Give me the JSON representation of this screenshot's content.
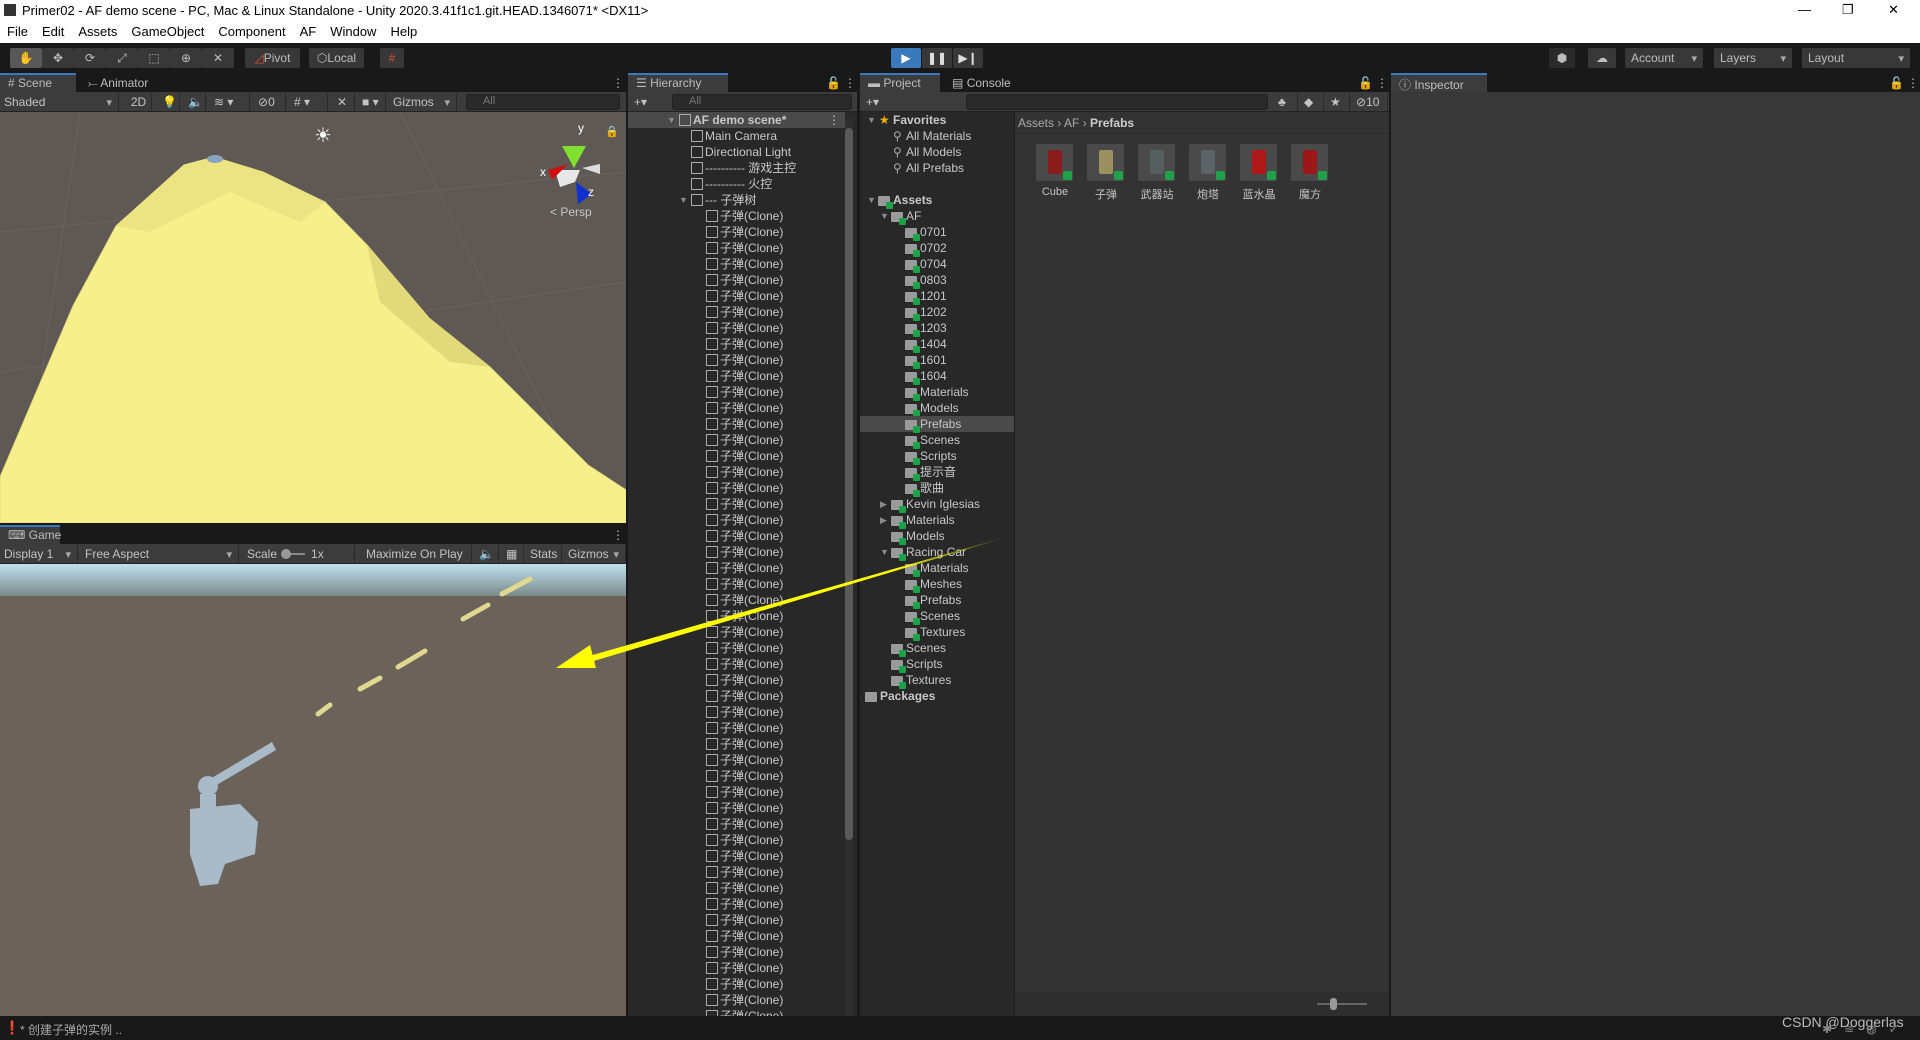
{
  "window": {
    "title": "Primer02 - AF demo scene - PC, Mac & Linux Standalone - Unity 2020.3.41f1c1.git.HEAD.1346071* <DX11>",
    "controls": [
      "minimize-icon",
      "restore-icon",
      "close-icon"
    ]
  },
  "menu": [
    "File",
    "Edit",
    "Assets",
    "GameObject",
    "Component",
    "AF",
    "Window",
    "Help"
  ],
  "toolbar": {
    "tools": [
      "hand-tool",
      "move-tool",
      "rotate-tool",
      "scale-tool",
      "rect-tool",
      "transform-tool",
      "custom-tool"
    ],
    "active_tool": "hand-tool",
    "pivot": "Pivot",
    "local": "Local",
    "account": "Account",
    "layers": "Layers",
    "layout": "Layout",
    "play_state": "stopped"
  },
  "scene_panel": {
    "tabs": [
      "Scene",
      "Animator"
    ],
    "active_tab": "Scene",
    "shading": "Shaded",
    "mode_2d": "2D",
    "hidden_count": "0",
    "gizmos": "Gizmos",
    "search_placeholder": "All",
    "persp": "Persp",
    "axes": {
      "x": "x",
      "y": "y",
      "z": "z"
    }
  },
  "game_panel": {
    "tab": "Game",
    "display": "Display 1",
    "aspect": "Free Aspect",
    "scale_label": "Scale",
    "scale_value": "1x",
    "maximize": "Maximize On Play",
    "stats": "Stats",
    "gizmos": "Gizmos"
  },
  "hierarchy": {
    "tab": "Hierarchy",
    "search_placeholder": "All",
    "scene": "AF demo scene*",
    "items": [
      {
        "label": "Main Camera"
      },
      {
        "label": "Directional Light"
      },
      {
        "label": "---------- 游戏主控"
      },
      {
        "label": "---------- 火控"
      },
      {
        "label": "--- 子弹树",
        "expanded": true,
        "children": [
          "子弹(Clone)",
          "子弹(Clone)",
          "子弹(Clone)",
          "子弹(Clone)",
          "子弹(Clone)",
          "子弹(Clone)",
          "子弹(Clone)",
          "子弹(Clone)",
          "子弹(Clone)",
          "子弹(Clone)",
          "子弹(Clone)",
          "子弹(Clone)",
          "子弹(Clone)",
          "子弹(Clone)",
          "子弹(Clone)",
          "子弹(Clone)",
          "子弹(Clone)",
          "子弹(Clone)",
          "子弹(Clone)",
          "子弹(Clone)",
          "子弹(Clone)",
          "子弹(Clone)",
          "子弹(Clone)",
          "子弹(Clone)",
          "子弹(Clone)",
          "子弹(Clone)",
          "子弹(Clone)",
          "子弹(Clone)",
          "子弹(Clone)",
          "子弹(Clone)",
          "子弹(Clone)",
          "子弹(Clone)",
          "子弹(Clone)",
          "子弹(Clone)",
          "子弹(Clone)",
          "子弹(Clone)",
          "子弹(Clone)",
          "子弹(Clone)",
          "子弹(Clone)",
          "子弹(Clone)",
          "子弹(Clone)",
          "子弹(Clone)",
          "子弹(Clone)",
          "子弹(Clone)",
          "子弹(Clone)",
          "子弹(Clone)",
          "子弹(Clone)",
          "子弹(Clone)",
          "子弹(Clone)",
          "子弹(Clone)",
          "子弹(Clone)"
        ]
      }
    ]
  },
  "project": {
    "tabs": [
      "Project",
      "Console"
    ],
    "active_tab": "Project",
    "hidden_count": "10",
    "favorites": {
      "label": "Favorites",
      "items": [
        "All Materials",
        "All Models",
        "All Prefabs"
      ]
    },
    "assets": {
      "label": "Assets",
      "children": [
        {
          "label": "AF",
          "expanded": true,
          "children": [
            {
              "label": "0701"
            },
            {
              "label": "0702"
            },
            {
              "label": "0704"
            },
            {
              "label": "0803"
            },
            {
              "label": "1201"
            },
            {
              "label": "1202"
            },
            {
              "label": "1203"
            },
            {
              "label": "1404"
            },
            {
              "label": "1601"
            },
            {
              "label": "1604"
            },
            {
              "label": "Materials"
            },
            {
              "label": "Models"
            },
            {
              "label": "Prefabs",
              "selected": true
            },
            {
              "label": "Scenes"
            },
            {
              "label": "Scripts"
            },
            {
              "label": "提示音"
            },
            {
              "label": "歌曲"
            }
          ]
        },
        {
          "label": "Kevin Iglesias",
          "collapsed": true
        },
        {
          "label": "Materials",
          "collapsed": true
        },
        {
          "label": "Models"
        },
        {
          "label": "Racing Car",
          "expanded": true,
          "children": [
            {
              "label": "Materials"
            },
            {
              "label": "Meshes"
            },
            {
              "label": "Prefabs"
            },
            {
              "label": "Scenes"
            },
            {
              "label": "Textures"
            }
          ]
        },
        {
          "label": "Scenes"
        },
        {
          "label": "Scripts"
        },
        {
          "label": "Textures"
        }
      ]
    },
    "packages": "Packages",
    "breadcrumb": [
      "Assets",
      "AF",
      "Prefabs"
    ],
    "grid_items": [
      {
        "label": "Cube",
        "color": "#8a1c1c"
      },
      {
        "label": "子弹",
        "color": "#9a9060"
      },
      {
        "label": "武器站",
        "color": "#55605e"
      },
      {
        "label": "炮塔",
        "color": "#5a6468"
      },
      {
        "label": "蓝水晶",
        "color": "#b01818"
      },
      {
        "label": "魔方",
        "color": "#9c1818"
      }
    ]
  },
  "inspector": {
    "tab": "Inspector"
  },
  "status": {
    "message": "* 创建子弹的实例 ..",
    "watermark": "CSDN @Doggerlas"
  },
  "colors": {
    "accent": "#3a79bb",
    "selection_yellow": "#f6ef8c",
    "arrow": "#ffff00"
  }
}
